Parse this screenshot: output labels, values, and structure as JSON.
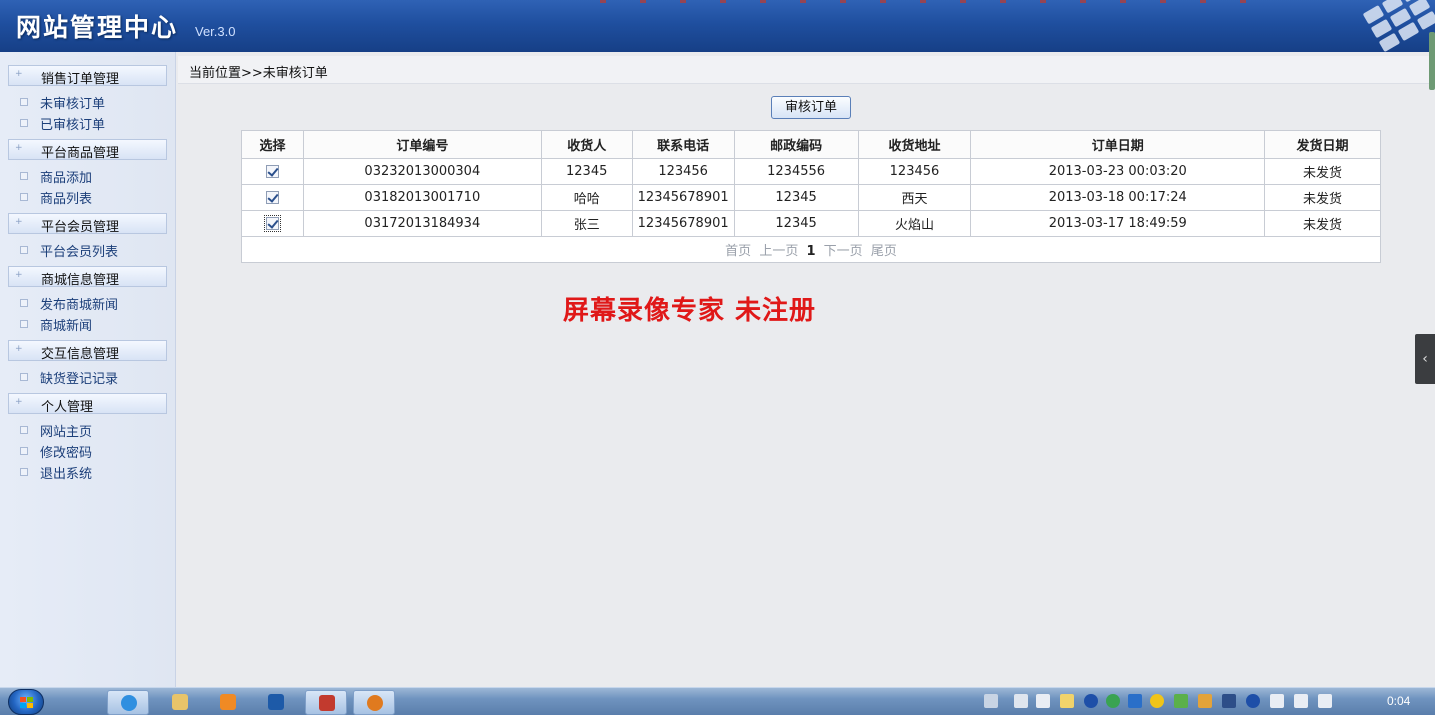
{
  "header": {
    "title": "网站管理中心",
    "version": "Ver.3.0"
  },
  "sidebar": {
    "groups": [
      {
        "label": "销售订单管理",
        "items": [
          "未审核订单",
          "已审核订单"
        ]
      },
      {
        "label": "平台商品管理",
        "items": [
          "商品添加",
          "商品列表"
        ]
      },
      {
        "label": "平台会员管理",
        "items": [
          "平台会员列表"
        ]
      },
      {
        "label": "商城信息管理",
        "items": [
          "发布商城新闻",
          "商城新闻"
        ]
      },
      {
        "label": "交互信息管理",
        "items": [
          "缺货登记记录"
        ]
      },
      {
        "label": "个人管理",
        "items": [
          "网站主页",
          "修改密码",
          "退出系统"
        ]
      }
    ]
  },
  "main": {
    "breadcrumb": "当前位置>>未审核订单",
    "audit_button": "审核订单",
    "table": {
      "headers": [
        "选择",
        "订单编号",
        "收货人",
        "联系电话",
        "邮政编码",
        "收货地址",
        "订单日期",
        "发货日期"
      ],
      "rows": [
        {
          "checked": true,
          "order_no": "03232013000304",
          "receiver": "12345",
          "phone": "123456",
          "postcode": "1234556",
          "address": "123456",
          "order_date": "2013-03-23 00:03:20",
          "ship_date": "未发货"
        },
        {
          "checked": true,
          "order_no": "03182013001710",
          "receiver": "哈哈",
          "phone": "12345678901",
          "postcode": "12345",
          "address": "西天",
          "order_date": "2013-03-18 00:17:24",
          "ship_date": "未发货"
        },
        {
          "checked": true,
          "order_no": "03172013184934",
          "receiver": "张三",
          "phone": "12345678901",
          "postcode": "12345",
          "address": "火焰山",
          "order_date": "2013-03-17 18:49:59",
          "ship_date": "未发货"
        }
      ],
      "pager": {
        "first": "首页",
        "prev": "上一页",
        "current": "1",
        "next": "下一页",
        "last": "尾页"
      }
    },
    "watermark": "屏幕录像专家  未注册"
  },
  "taskbar": {
    "clock": "0:04",
    "apps": [
      "internet-explorer",
      "file-explorer",
      "media-player",
      "app-blue",
      "app-red",
      "app-orange"
    ],
    "tray_icons": [
      "keyboard-icon",
      "network-icon",
      "usb-icon",
      "flag-icon",
      "bluetooth-icon",
      "update-icon",
      "app-icon",
      "chrome-icon",
      "leaf-icon",
      "user-icon",
      "display-icon",
      "bluetooth-icon",
      "power-icon",
      "signal-icon",
      "volume-icon"
    ]
  },
  "colors": {
    "header": "#1f4f9f",
    "watermark": "#e01818",
    "sidebar_link": "#1c3f7a"
  }
}
